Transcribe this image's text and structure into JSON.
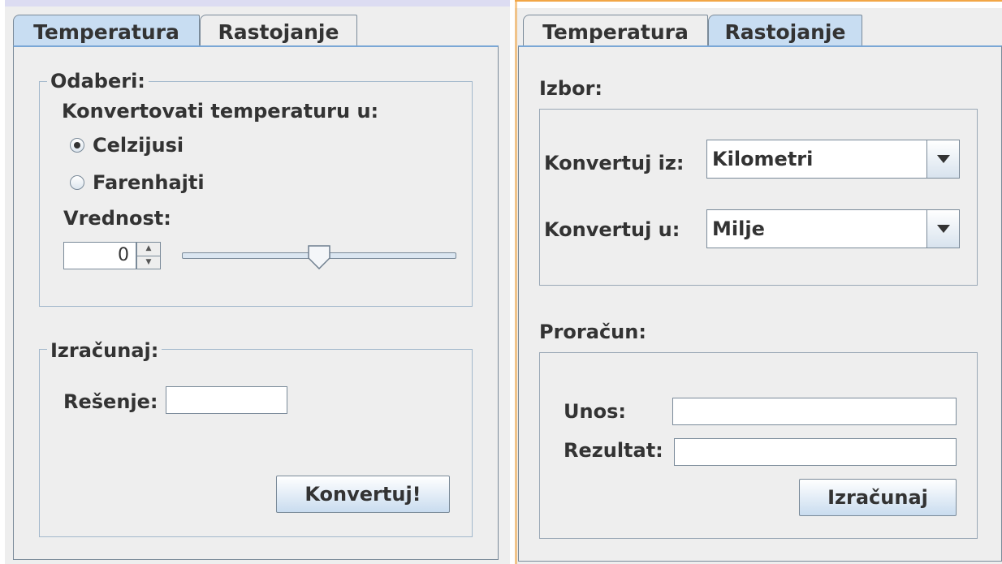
{
  "left_panel": {
    "tabs": [
      {
        "label": "Temperatura",
        "active": true
      },
      {
        "label": "Rastojanje",
        "active": false
      }
    ],
    "odaberi_group": {
      "legend": "Odaberi:",
      "prompt": "Konvertovati temperaturu u:",
      "options": [
        {
          "label": "Celzijusi",
          "selected": true
        },
        {
          "label": "Farenhajti",
          "selected": false
        }
      ],
      "value_label": "Vrednost:",
      "spinner_value": "0",
      "slider_level": 0.5
    },
    "izracunaj_group": {
      "legend": "Izračunaj:",
      "result_label": "Rešenje:",
      "result_value": "",
      "convert_button": "Konvertuj!"
    }
  },
  "right_panel": {
    "tabs": [
      {
        "label": "Temperatura",
        "active": false
      },
      {
        "label": "Rastojanje",
        "active": true
      }
    ],
    "izbor": {
      "heading": "Izbor:",
      "from_label": "Konvertuj iz:",
      "from_value": "Kilometri",
      "to_label": "Konvertuj u:",
      "to_value": "Milje"
    },
    "proracun": {
      "heading": "Proračun:",
      "input_label": "Unos:",
      "input_value": "",
      "result_label": "Rezultat:",
      "result_value": "",
      "calc_button": "Izračunaj"
    }
  },
  "colors": {
    "panel_bg": "#eeeeee",
    "active_tab": "#c8ddf2",
    "border": "#7a8a99",
    "group_border": "#a3b8cc",
    "text": "#333333"
  }
}
